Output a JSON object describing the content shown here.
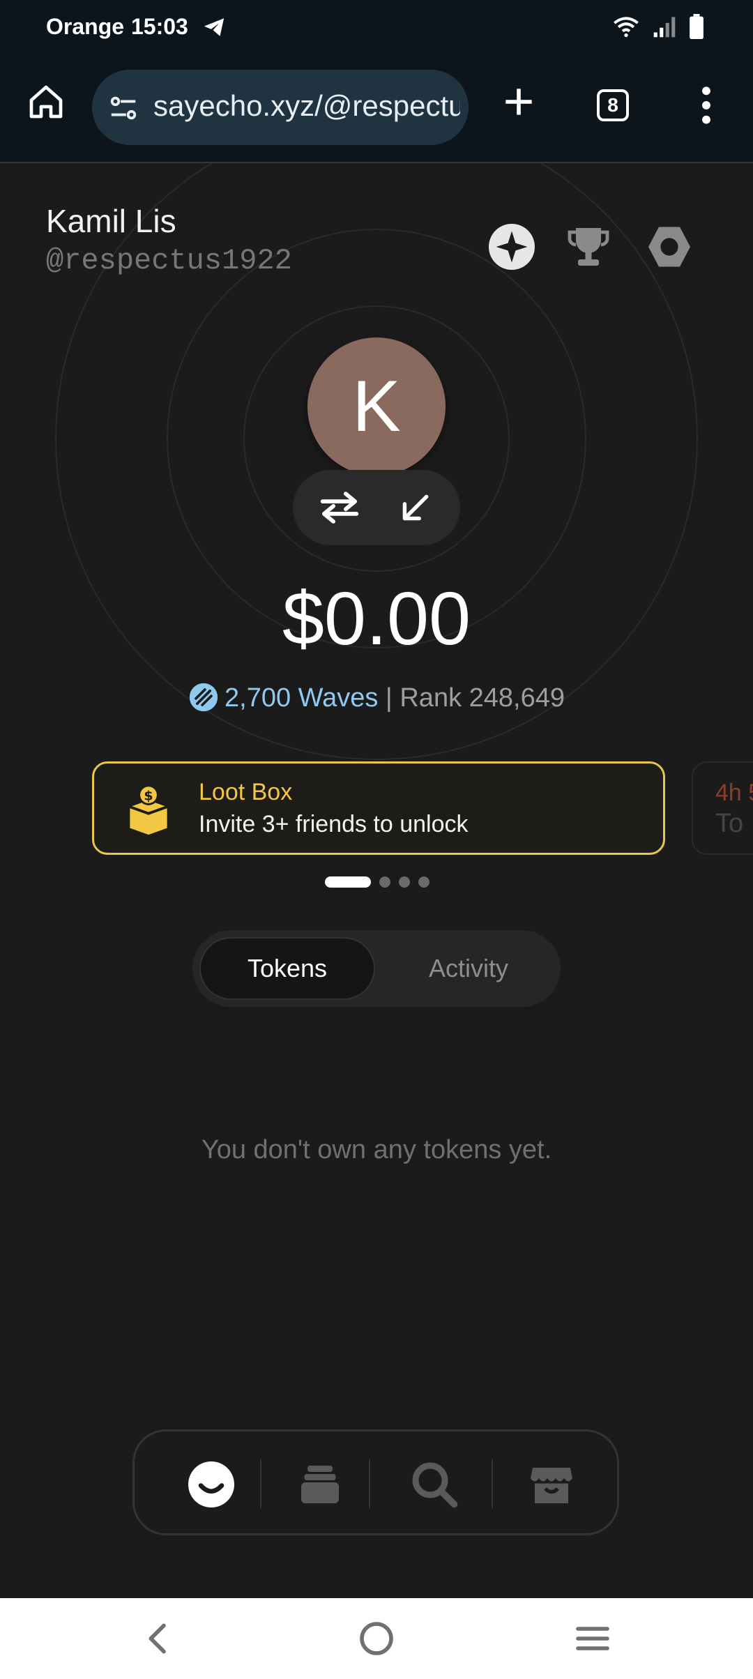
{
  "status_bar": {
    "carrier": "Orange",
    "time": "15:03",
    "icons": [
      "telegram-icon",
      "wifi-icon",
      "signal-icon",
      "battery-icon"
    ]
  },
  "browser": {
    "url": "sayecho.xyz/@respectus1922",
    "tab_count": "8"
  },
  "profile": {
    "name": "Kamil Lis",
    "handle": "@respectus1922",
    "avatar_letter": "K",
    "header_icons": [
      "sparkle-icon",
      "trophy-icon",
      "settings-hexagon-icon"
    ]
  },
  "wallet": {
    "balance": "$0.00",
    "waves": "2,700 Waves",
    "rank": " | Rank 248,649"
  },
  "carousel": {
    "cards": [
      {
        "title": "Loot Box",
        "subtitle": "Invite 3+ friends to unlock"
      },
      {
        "title": "4h 5",
        "subtitle": "To"
      }
    ],
    "active_index": 0,
    "count": 4
  },
  "tabs": {
    "items": [
      "Tokens",
      "Activity"
    ],
    "selected": "Tokens"
  },
  "empty_state": "You don't own any tokens yet.",
  "bottom_nav": [
    "profile-smile-icon",
    "stack-icon",
    "search-icon",
    "shop-icon"
  ],
  "colors": {
    "background": "#1b1b1b",
    "accent_waves": "#8fc9ef",
    "lootbox_gold": "#f2c744",
    "avatar": "#8a6a5e"
  }
}
